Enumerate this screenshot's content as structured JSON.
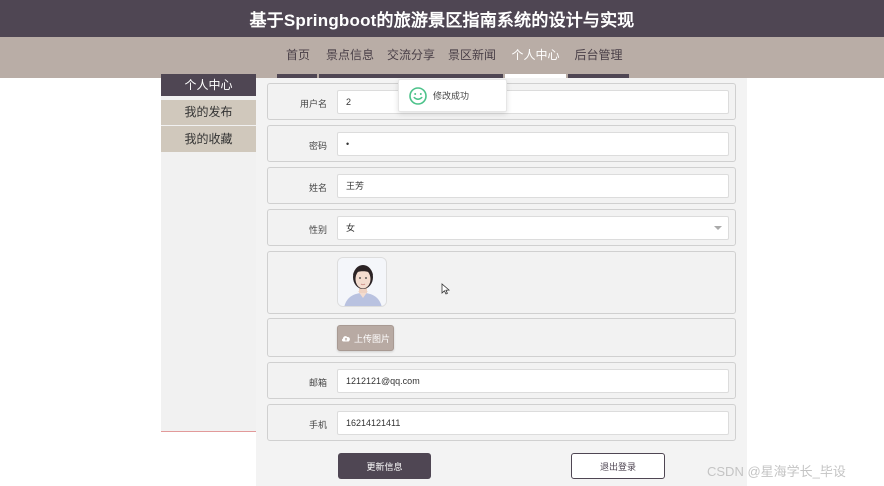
{
  "app": {
    "title": "基于Springboot的旅游景区指南系统的设计与实现"
  },
  "nav": {
    "items": [
      {
        "label": "首页"
      },
      {
        "label": "景点信息"
      },
      {
        "label": "交流分享"
      },
      {
        "label": "景区新闻"
      },
      {
        "label": "个人中心",
        "active": true
      },
      {
        "label": "后台管理"
      }
    ]
  },
  "sidebar": {
    "items": [
      {
        "label": "个人中心",
        "active": true
      },
      {
        "label": "我的发布"
      },
      {
        "label": "我的收藏"
      }
    ]
  },
  "form": {
    "username": {
      "label": "用户名",
      "value": "2"
    },
    "password": {
      "label": "密码",
      "value": "•"
    },
    "name": {
      "label": "姓名",
      "value": "王芳"
    },
    "gender": {
      "label": "性别",
      "value": "女"
    },
    "upload_label": "上传图片",
    "email": {
      "label": "邮箱",
      "value": "1212121@qq.com"
    },
    "phone": {
      "label": "手机",
      "value": "16214121411"
    }
  },
  "buttons": {
    "update": "更新信息",
    "logout": "退出登录"
  },
  "toast": {
    "message": "修改成功"
  },
  "watermark": "CSDN @星海学长_毕设",
  "colors": {
    "primary": "#4f4653",
    "nav_bg": "#b9ada6",
    "sidebar_item_bg": "#d0c8bc",
    "toast_icon": "#4cc28a"
  },
  "icons": [
    "smile-check-icon",
    "cloud-upload-icon",
    "chevron-down-icon",
    "mouse-cursor-icon"
  ]
}
